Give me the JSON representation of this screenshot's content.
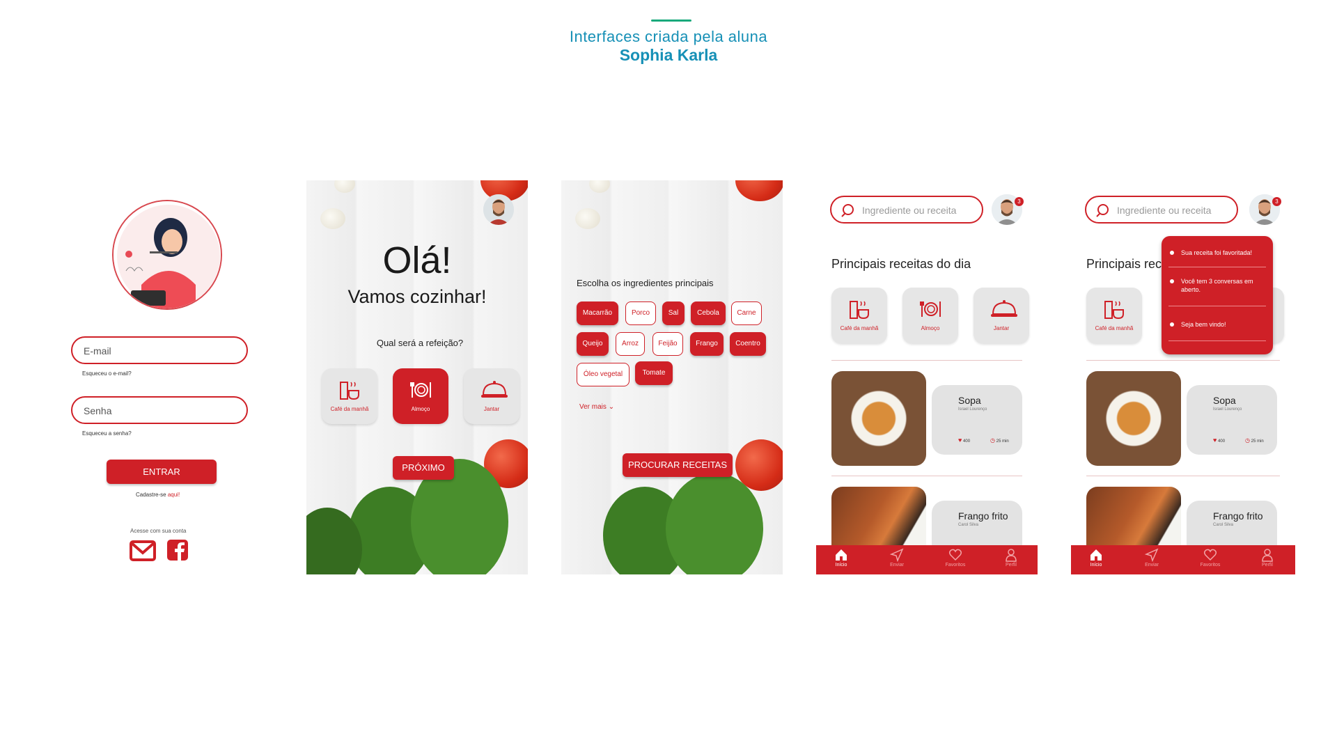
{
  "header": {
    "line1": "Interfaces criada pela aluna",
    "line2": "Sophia Karla"
  },
  "login": {
    "email_placeholder": "E-mail",
    "forgot_email": "Esqueceu o e-mail?",
    "password_placeholder": "Senha",
    "forgot_password": "Esqueceu a senha?",
    "enter_button": "ENTRAR",
    "signup_text": "Cadastre-se",
    "signup_link": "aqui!",
    "social_text": "Acesse com sua conta",
    "icons": [
      "mail-icon",
      "facebook-icon"
    ]
  },
  "welcome": {
    "hello": "Olá!",
    "subtitle": "Vamos cozinhar!",
    "question": "Qual será a refeição?",
    "meals": [
      "Café da manhã",
      "Almoço",
      "Jantar"
    ],
    "selected_meal": "Almoço",
    "next_button": "PRÓXIMO"
  },
  "ingredients": {
    "title": "Escolha os ingredientes principais",
    "chips": [
      {
        "label": "Macarrão",
        "selected": true
      },
      {
        "label": "Porco",
        "selected": false
      },
      {
        "label": "Sal",
        "selected": true
      },
      {
        "label": "Cebola",
        "selected": true
      },
      {
        "label": "Carne",
        "selected": false
      },
      {
        "label": "Queijo",
        "selected": true
      },
      {
        "label": "Arroz",
        "selected": false
      },
      {
        "label": "Feijão",
        "selected": false
      },
      {
        "label": "Frango",
        "selected": true
      },
      {
        "label": "Coentro",
        "selected": true
      },
      {
        "label": "Óleo vegetal",
        "selected": false
      },
      {
        "label": "Tomate",
        "selected": true
      }
    ],
    "see_more": "Ver mais",
    "search_button": "PROCURAR RECEITAS"
  },
  "home": {
    "search_placeholder": "Ingrediente ou receita",
    "badge_count": "3",
    "section_title": "Principais receitas do dia",
    "meals": [
      "Café da manhã",
      "Almoço",
      "Jantar"
    ],
    "recipes": [
      {
        "name": "Sopa",
        "author": "Israel Lourenço",
        "likes": "400",
        "time": "25 min"
      },
      {
        "name": "Frango frito",
        "author": "Carol Silva"
      }
    ],
    "nav": [
      "Início",
      "Enviar",
      "Favoritos",
      "Perfil"
    ]
  },
  "notifications": {
    "section_title": "Principais rec",
    "items": [
      "Sua receita foi favoritada!",
      "Você tem 3 conversas em aberto.",
      "Seja bem vindo!"
    ]
  },
  "colors": {
    "primary": "#cf2027",
    "header": "#1690b6",
    "accent_line": "#19a97b"
  }
}
